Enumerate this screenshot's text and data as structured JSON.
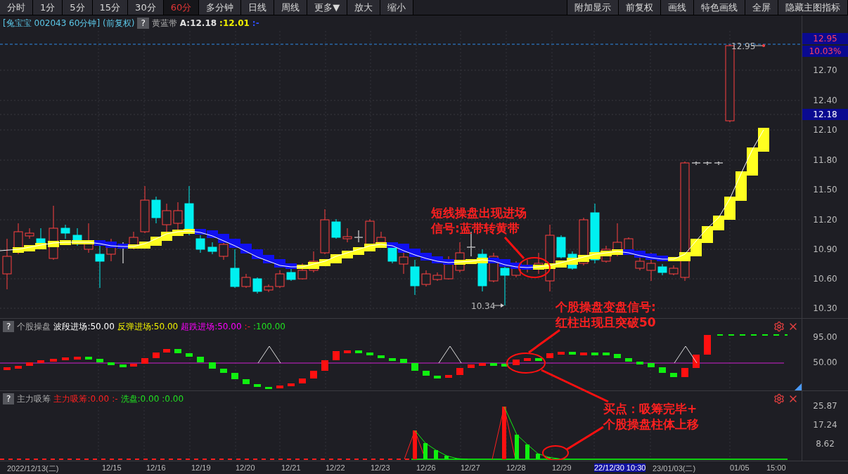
{
  "toolbar": {
    "left": [
      {
        "label": "分时",
        "selected": false
      },
      {
        "label": "1分",
        "selected": false
      },
      {
        "label": "5分",
        "selected": false
      },
      {
        "label": "15分",
        "selected": false
      },
      {
        "label": "30分",
        "selected": false
      },
      {
        "label": "60分",
        "selected": true
      },
      {
        "label": "多分钟",
        "selected": false
      },
      {
        "label": "日线",
        "selected": false
      },
      {
        "label": "周线",
        "selected": false
      },
      {
        "label": "更多▼",
        "selected": false
      },
      {
        "label": "放大",
        "selected": false
      },
      {
        "label": "缩小",
        "selected": false
      }
    ],
    "right": [
      {
        "label": "附加显示"
      },
      {
        "label": "前复权"
      },
      {
        "label": "画线"
      },
      {
        "label": "特色画线"
      },
      {
        "label": "全屏"
      },
      {
        "label": "隐藏主图指标"
      }
    ]
  },
  "main_panel": {
    "title": "[兔宝宝 002043 60分钟]",
    "adjust": "(前复权)",
    "help": "?",
    "indicator": "黄蓝带",
    "values": [
      {
        "text": "A:12.18",
        "color": "#e0e0e0"
      },
      {
        "text": ":12.01",
        "color": "#f0f000"
      },
      {
        "text": ":-",
        "color": "#3050ff"
      }
    ],
    "price_axis": [
      {
        "label": "12.95",
        "kind": "high"
      },
      {
        "label": "10.03%",
        "kind": "high"
      },
      {
        "label": "12.70",
        "kind": "tick"
      },
      {
        "label": "12.40",
        "kind": "tick"
      },
      {
        "label": "12.18",
        "kind": "current"
      },
      {
        "label": "12.10",
        "kind": "tick"
      },
      {
        "label": "11.80",
        "kind": "tick"
      },
      {
        "label": "11.50",
        "kind": "tick"
      },
      {
        "label": "11.20",
        "kind": "tick"
      },
      {
        "label": "10.90",
        "kind": "tick"
      },
      {
        "label": "10.60",
        "kind": "tick"
      },
      {
        "label": "10.30",
        "kind": "tick"
      }
    ],
    "high_label": "12.95",
    "low_label": "10.34"
  },
  "sub_panels": [
    {
      "help": "?",
      "name": "个股操盘",
      "values": [
        {
          "text": "波段进场:50.00",
          "color": "#ffffff"
        },
        {
          "text": "反弹进场:50.00",
          "color": "#f0f000"
        },
        {
          "text": "超跌进场:50.00",
          "color": "#ff00ff"
        },
        {
          "text": ":-",
          "color": "#ff2020"
        },
        {
          "text": ":100.00",
          "color": "#20e020"
        }
      ],
      "axis": [
        "95.00",
        "50.00"
      ]
    },
    {
      "help": "?",
      "name": "主力吸筹",
      "values": [
        {
          "text": "主力吸筹:0.00",
          "color": "#ff2020"
        },
        {
          "text": ":-",
          "color": "#ff2020"
        },
        {
          "text": "洗盘:0.00",
          "color": "#20e020"
        },
        {
          "text": ":0.00",
          "color": "#20e020"
        }
      ],
      "axis": [
        "25.87",
        "17.24",
        "8.62"
      ]
    }
  ],
  "annotations": [
    {
      "lines": [
        "短线操盘出现进场",
        "信号:蓝带转黄带"
      ]
    },
    {
      "lines": [
        "个股操盘变盘信号:",
        "红柱出现且突破50"
      ]
    },
    {
      "lines": [
        "买点：吸筹完毕+",
        "个股操盘柱体上移"
      ]
    }
  ],
  "time_axis": [
    {
      "label": "2022/12/13(二)",
      "selected": false
    },
    {
      "label": "12/15",
      "selected": false
    },
    {
      "label": "12/16",
      "selected": false
    },
    {
      "label": "12/19",
      "selected": false
    },
    {
      "label": "12/20",
      "selected": false
    },
    {
      "label": "12/21",
      "selected": false
    },
    {
      "label": "12/22",
      "selected": false
    },
    {
      "label": "12/23",
      "selected": false
    },
    {
      "label": "12/26",
      "selected": false
    },
    {
      "label": "12/27",
      "selected": false
    },
    {
      "label": "12/28",
      "selected": false
    },
    {
      "label": "12/29",
      "selected": false
    },
    {
      "label": "22/12/30 10:30",
      "selected": true
    },
    {
      "label": "23/01/03(二)",
      "selected": false
    },
    {
      "label": "01/05",
      "selected": false
    },
    {
      "label": "15:00",
      "selected": false
    }
  ]
}
